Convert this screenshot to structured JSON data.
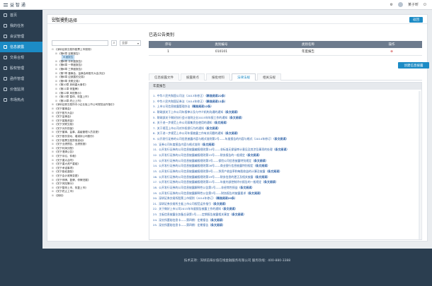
{
  "topbar": {
    "brand": "益 智 通",
    "user": "某子昕"
  },
  "sidebar": {
    "items": [
      {
        "label": "首页",
        "active": false
      },
      {
        "label": "我的任务",
        "active": false
      },
      {
        "label": "会议管理",
        "active": false
      },
      {
        "label": "信息披露",
        "active": true
      },
      {
        "label": "交易合规",
        "active": false
      },
      {
        "label": "股权管理",
        "active": false
      },
      {
        "label": "函件管理",
        "active": false
      },
      {
        "label": "价值监测",
        "active": false
      },
      {
        "label": "市场热点",
        "active": false
      }
    ]
  },
  "breadcrumb": "信披小助手",
  "back_label": "返回",
  "left": {
    "title": "公告类别选择",
    "search_placeholder": "",
    "select_value": "全部",
    "tree": [
      {
        "indent": 0,
        "toggle": "⊟",
        "label": "《深圳证券交易所股票上市规则》"
      },
      {
        "indent": 1,
        "toggle": "⊞",
        "label": "《第6章 定期报告》"
      },
      {
        "indent": 2,
        "toggle": "",
        "label": "年度报告",
        "selected": true
      },
      {
        "indent": 1,
        "toggle": "⊞",
        "label": "《第6章 半年度报告》"
      },
      {
        "indent": 1,
        "toggle": "⊞",
        "label": "《第6章 一季度报告》"
      },
      {
        "indent": 1,
        "toggle": "⊞",
        "label": "《第6章 三季度报告》"
      },
      {
        "indent": 1,
        "toggle": "⊞",
        "label": "《第7章 董事会、监事会和股东大会决议》"
      },
      {
        "indent": 1,
        "toggle": "⊞",
        "label": "《第8章 应披露的交易》"
      },
      {
        "indent": 1,
        "toggle": "⊞",
        "label": "《第9章 关联交易》"
      },
      {
        "indent": 1,
        "toggle": "⊞",
        "label": "《第10章 其他重大事件》"
      },
      {
        "indent": 1,
        "toggle": "⊞",
        "label": "《第11章 停复牌》"
      },
      {
        "indent": 1,
        "toggle": "⊞",
        "label": "《第12章 风险警示》"
      },
      {
        "indent": 1,
        "toggle": "⊞",
        "label": "《第13章 暂停、恢复上市》"
      },
      {
        "indent": 1,
        "toggle": "⊞",
        "label": "《第14章 终止上市》"
      },
      {
        "indent": 0,
        "toggle": "⊞",
        "label": "《深圳证券交易所中小企业板上市公司规范运作指引》"
      },
      {
        "indent": 0,
        "toggle": "⊞",
        "label": "《关于董事会》"
      },
      {
        "indent": 0,
        "toggle": "⊞",
        "label": "《关于股东大会》"
      },
      {
        "indent": 0,
        "toggle": "⊞",
        "label": "《关于监事会》"
      },
      {
        "indent": 0,
        "toggle": "⊞",
        "label": "《关于募集资金》"
      },
      {
        "indent": 0,
        "toggle": "⊞",
        "label": "《关于关联交易》"
      },
      {
        "indent": 0,
        "toggle": "⊞",
        "label": "《关于对外担保》"
      },
      {
        "indent": 0,
        "toggle": "⊞",
        "label": "《关于董事、监事、高级管理人员变更》"
      },
      {
        "indent": 0,
        "toggle": "⊞",
        "label": "《关于股份变动、增减持公司股份》"
      },
      {
        "indent": 0,
        "toggle": "⊞",
        "label": "《关于股票交易异常波动》"
      },
      {
        "indent": 0,
        "toggle": "⊞",
        "label": "《关于业绩预告、业绩快报》"
      },
      {
        "indent": 0,
        "toggle": "⊞",
        "label": "《关于利润分配》"
      },
      {
        "indent": 0,
        "toggle": "⊞",
        "label": "《关于澄清公告》"
      },
      {
        "indent": 0,
        "toggle": "⊞",
        "label": "《关于诉讼、仲裁》"
      },
      {
        "indent": 0,
        "toggle": "⊞",
        "label": "《关于重大合同》"
      },
      {
        "indent": 0,
        "toggle": "⊞",
        "label": "《关于重大资产重组》"
      },
      {
        "indent": 0,
        "toggle": "⊞",
        "label": "《关于承诺事项》"
      },
      {
        "indent": 0,
        "toggle": "⊞",
        "label": "《关于股权激励》"
      },
      {
        "indent": 0,
        "toggle": "⊞",
        "label": "《关于会计政策变更》"
      },
      {
        "indent": 0,
        "toggle": "⊞",
        "label": "《关于停牌、复牌、停牌进展》"
      },
      {
        "indent": 0,
        "toggle": "⊞",
        "label": "《关于风险警示》"
      },
      {
        "indent": 0,
        "toggle": "⊞",
        "label": "《关于暂停上市、恢复上市》"
      },
      {
        "indent": 0,
        "toggle": "⊞",
        "label": "《关于终止上市》"
      },
      {
        "indent": 0,
        "toggle": "⊞",
        "label": "《其他》"
      }
    ]
  },
  "right": {
    "title": "已选公告类别",
    "table_headers": [
      "序号",
      "类别编号",
      "类别名称",
      "操作"
    ],
    "rows": [
      {
        "no": "1",
        "code": "010101",
        "name": "年度报告",
        "op": "⊗"
      }
    ],
    "create_button": "创建信息披露",
    "tabs": [
      "信息披露文件",
      "披露要点",
      "报批材料",
      "法律法规",
      "相关法规"
    ],
    "active_tab": 3,
    "panel_title": "年度报告",
    "links": [
      {
        "n": "1.",
        "text": "中华人民共和国公司法（2013年修正）",
        "tag": "（精准阅读22条）"
      },
      {
        "n": "2.",
        "text": "中华人民共和国证券法（2014年修正）",
        "tag": "（精准阅读11条）"
      },
      {
        "n": "3.",
        "text": "上市公司信息披露管理办法",
        "tag": "（精准阅读12条）"
      },
      {
        "n": "4.",
        "text": "财政部关于上市公司年报审计及与中介机构沟通的通知",
        "tag": "（条文阅读）"
      },
      {
        "n": "5.",
        "text": "财政部关于做好执行会计准则企业2015年年报工作的通知",
        "tag": "（条文阅读）"
      },
      {
        "n": "6.",
        "text": "关于进一步规范上市公司募集资金使用的通知",
        "tag": "（条文阅读）"
      },
      {
        "n": "7.",
        "text": "关于规范上市公司对外担保行为的通知",
        "tag": "（条文阅读）"
      },
      {
        "n": "8.",
        "text": "关于进一步规范上市公司年报披露工作有关问题的通知",
        "tag": "（条文阅读）"
      },
      {
        "n": "9.",
        "text": "公开发行证券的公司信息披露内容与格式准则第2号——年度报告的内容与格式（2014年修订）",
        "tag": "（条文阅读）"
      },
      {
        "n": "10.",
        "text": "证券公司年度报告内容与格式准则",
        "tag": "（条文阅读）"
      },
      {
        "n": "11.",
        "text": "公开发行证券的公司信息披露编报规则第14号——非标准无保留审计意见及其涉及事项的处理",
        "tag": "（条文阅读）"
      },
      {
        "n": "12.",
        "text": "公开发行证券的公司信息披露编报规则第15号——财务报告的一般规定",
        "tag": "（条文阅读）"
      },
      {
        "n": "13.",
        "text": "公开发行证券的公司信息披露编报规则第3号——保险公司信息披露特别规定",
        "tag": "（条文阅读）"
      },
      {
        "n": "14.",
        "text": "公开发行证券的公司信息披露编报规则第26号——商业银行信息披露特别规定",
        "tag": "（条文阅读）"
      },
      {
        "n": "15.",
        "text": "公开发行证券的公司信息披露编报规则第9号——净资产收益率和每股收益的计算及披露",
        "tag": "（条文阅读）"
      },
      {
        "n": "16.",
        "text": "公开发行证券的公司信息披露编报规则第19号——财务信息的更正及相关披露",
        "tag": "（条文阅读）"
      },
      {
        "n": "17.",
        "text": "公开发行证券的公司信息披露编报规则第21号——年度内部控制评价报告的一般规定",
        "tag": "（条文阅读）"
      },
      {
        "n": "18.",
        "text": "公开发行证券的公司信息披露解释性公告第1号——非经常性损益",
        "tag": "（条文阅读）"
      },
      {
        "n": "19.",
        "text": "公开发行证券的公司信息披露解释性公告第3号——财务报告的披露要求",
        "tag": "（条文阅读）"
      },
      {
        "n": "20.",
        "text": "深圳证券交易所股票上市规则（2014年修订）",
        "tag": "（精准阅读20条）"
      },
      {
        "n": "21.",
        "text": "深圳证券交易所主板上市公司规范运作指引",
        "tag": "（条文阅读）"
      },
      {
        "n": "22.",
        "text": "关于做好上市公司2015年年度报告披露工作的通知",
        "tag": "（条文阅读）"
      },
      {
        "n": "23.",
        "text": "主板信息披露业务备忘录第1号——定期报告披露相关事宜",
        "tag": "（条文阅读）"
      },
      {
        "n": "24.",
        "text": "深交所董秘信息卡——第四期：定期报告",
        "tag": "（条文阅读）"
      },
      {
        "n": "25.",
        "text": "深交所董秘信息卡——第四期：定期报告",
        "tag": "（条文阅读）"
      }
    ]
  },
  "footer": {
    "text": "技术支持：深圳前海价值在线金融服务有限公司  服务热线：400-880-3388"
  }
}
